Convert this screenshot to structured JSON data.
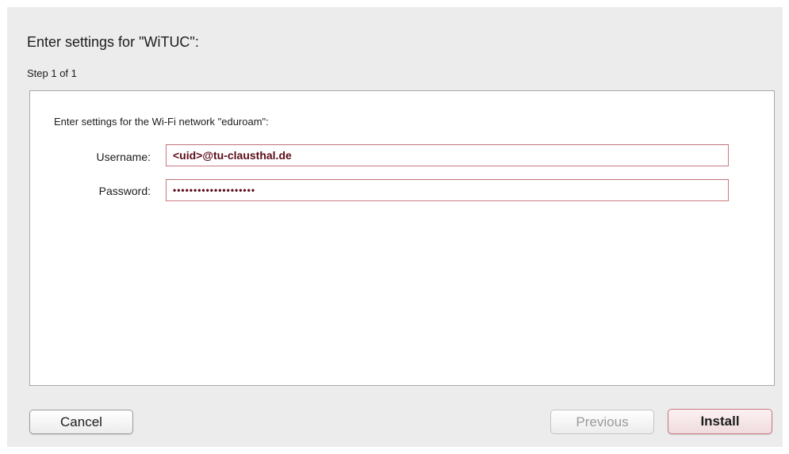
{
  "dialog": {
    "title": "Enter settings for \"WiTUC\":",
    "step": "Step 1 of 1",
    "panel_heading": "Enter settings for the Wi-Fi network \"eduroam\":",
    "fields": [
      {
        "label": "Username:",
        "value": "<uid>@tu-clausthal.de"
      },
      {
        "label": "Password:",
        "value": "••••••••••••••••••••"
      }
    ],
    "buttons": {
      "cancel": "Cancel",
      "previous": "Previous",
      "install": "Install"
    }
  },
  "colors": {
    "focus_border": "#c87a80",
    "default_button": "#efdcde",
    "disabled_text": "#9a9a9a"
  }
}
